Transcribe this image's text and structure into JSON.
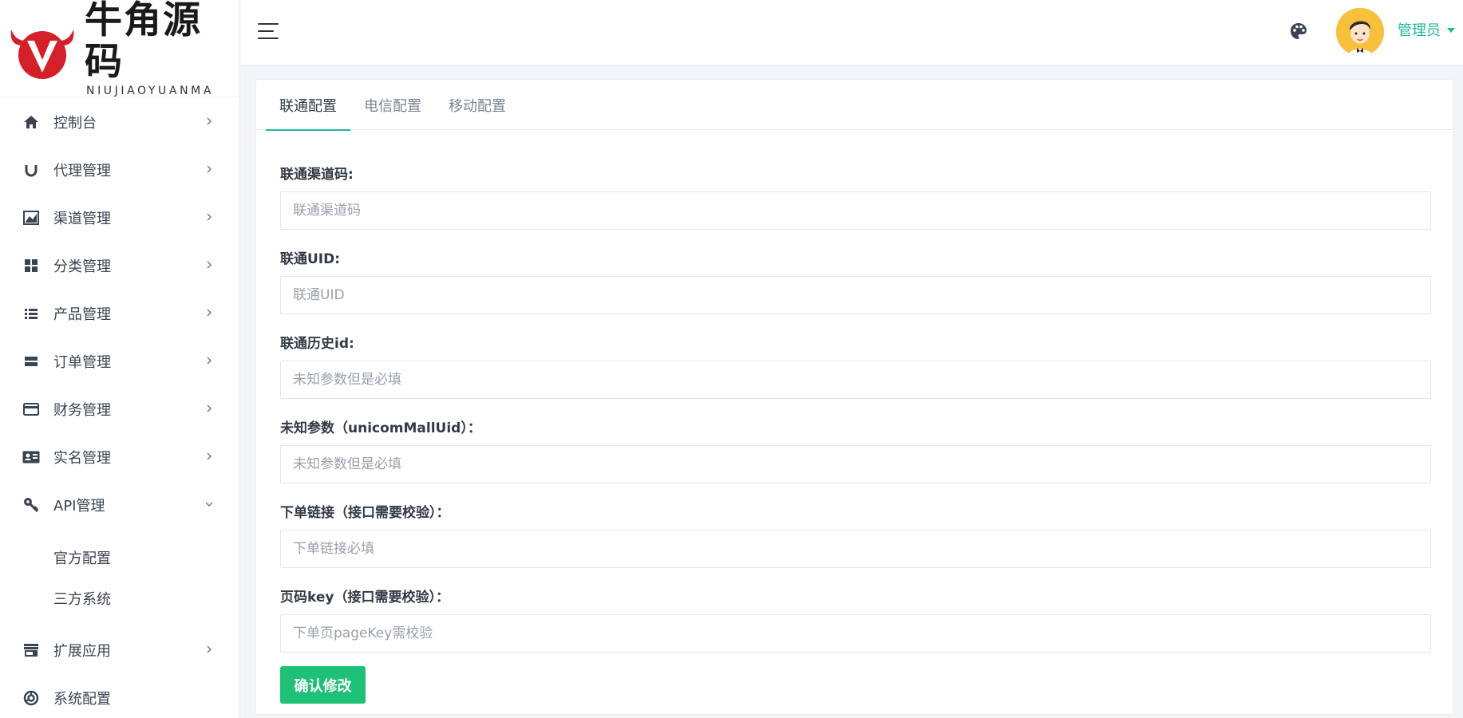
{
  "brand": {
    "name_cn": "牛角源码",
    "name_en": "NIUJIAOYUANMA",
    "color": "#d5202a"
  },
  "sidebar": {
    "items": [
      {
        "label": "控制台",
        "icon": "home-icon",
        "expanded": false
      },
      {
        "label": "代理管理",
        "icon": "magnet-icon",
        "expanded": false
      },
      {
        "label": "渠道管理",
        "icon": "chart-icon",
        "expanded": false
      },
      {
        "label": "分类管理",
        "icon": "grid-icon",
        "expanded": false
      },
      {
        "label": "产品管理",
        "icon": "list-icon",
        "expanded": false
      },
      {
        "label": "订单管理",
        "icon": "order-icon",
        "expanded": false
      },
      {
        "label": "财务管理",
        "icon": "card-icon",
        "expanded": false
      },
      {
        "label": "实名管理",
        "icon": "id-card-icon",
        "expanded": false
      },
      {
        "label": "API管理",
        "icon": "key-icon",
        "expanded": true
      },
      {
        "label": "扩展应用",
        "icon": "store-icon",
        "expanded": false
      },
      {
        "label": "系统配置",
        "icon": "settings-icon",
        "expanded": false
      }
    ],
    "api_sub": [
      "官方配置",
      "三方系统"
    ]
  },
  "header": {
    "user_name": "管理员"
  },
  "tabs": [
    {
      "label": "联通配置",
      "active": true
    },
    {
      "label": "电信配置",
      "active": false
    },
    {
      "label": "移动配置",
      "active": false
    }
  ],
  "form": {
    "fields": [
      {
        "label": "联通渠道码:",
        "placeholder": "联通渠道码",
        "value": ""
      },
      {
        "label": "联通UID:",
        "placeholder": "联通UID",
        "value": ""
      },
      {
        "label": "联通历史id:",
        "placeholder": "未知参数但是必填",
        "value": ""
      },
      {
        "label": "未知参数（unicomMallUid）：",
        "placeholder": "未知参数但是必填",
        "value": ""
      },
      {
        "label": "下单链接（接口需要校验）：",
        "placeholder": "下单链接必填",
        "value": ""
      },
      {
        "label": "页码key（接口需要校验）：",
        "placeholder": "下单页pageKey需校验",
        "value": ""
      }
    ],
    "submit_label": "确认修改"
  },
  "colors": {
    "accent": "#1fb89a",
    "button": "#1fc176"
  }
}
